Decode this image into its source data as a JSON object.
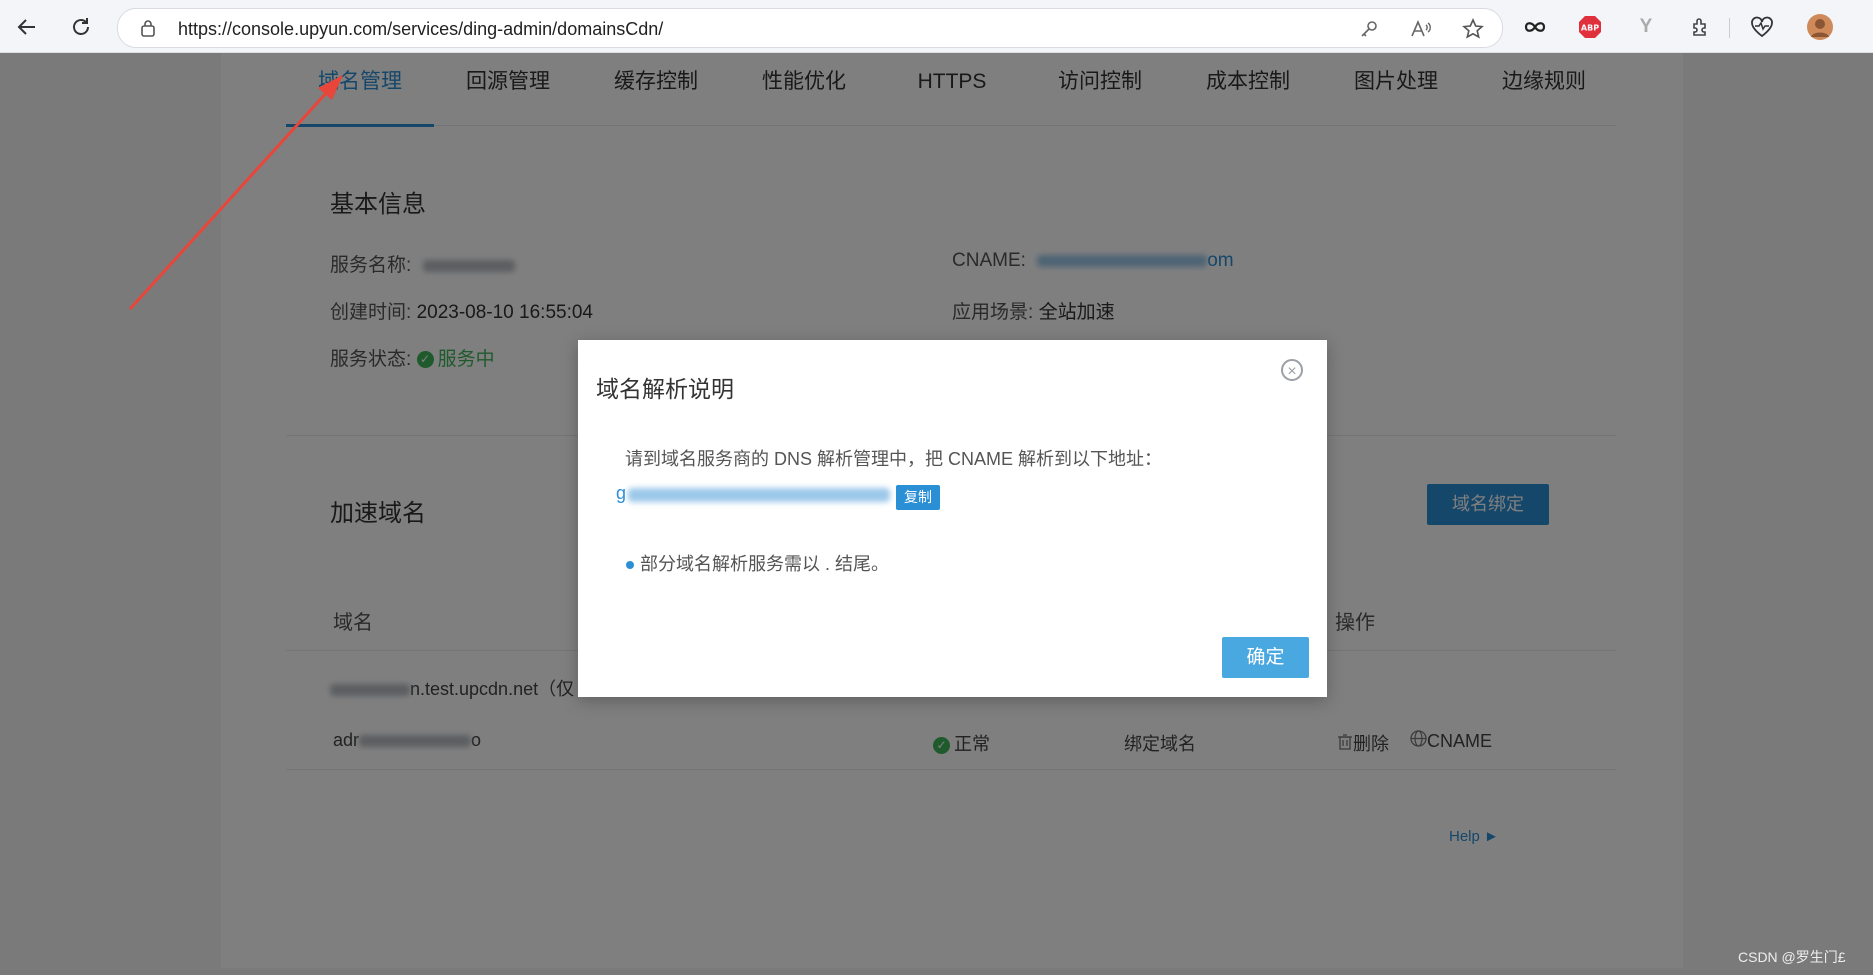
{
  "browser": {
    "url": "https://console.upyun.com/services/ding-admin/domainsCdn/",
    "icons": [
      "back-icon",
      "refresh-icon",
      "lock-icon",
      "key-icon",
      "read-aloud-icon",
      "favorite-star-icon",
      "infinity-icon",
      "abp-icon",
      "y-extension-icon",
      "extensions-icon",
      "heart-pulse-icon",
      "profile-avatar"
    ],
    "abp_label": "ABP",
    "ext_y_label": "Y"
  },
  "tabs": [
    {
      "label": "域名管理",
      "active": true
    },
    {
      "label": "回源管理"
    },
    {
      "label": "缓存控制"
    },
    {
      "label": "性能优化"
    },
    {
      "label": "HTTPS"
    },
    {
      "label": "访问控制"
    },
    {
      "label": "成本控制"
    },
    {
      "label": "图片处理"
    },
    {
      "label": "边缘规则"
    }
  ],
  "basic_info": {
    "title": "基本信息",
    "service_name_label": "服务名称:",
    "cname_label": "CNAME:",
    "cname_suffix": "om",
    "created_label": "创建时间:",
    "created_value": "2023-08-10 16:55:04",
    "scenario_label": "应用场景:",
    "scenario_value": "全站加速",
    "status_label": "服务状态:",
    "status_value": "服务中"
  },
  "accel_domains": {
    "title": "加速域名",
    "bind_button": "域名绑定",
    "col_domain": "域名",
    "col_ops": "操作",
    "row1_domain_suffix": "n.test.upcdn.net（仅",
    "row2_domain_prefix": "adr",
    "row2_domain_suffix": "o",
    "row2_status": "正常",
    "row2_type": "绑定域名",
    "row2_delete": "删除",
    "row2_cname": "CNAME"
  },
  "help_link": "Help ►",
  "dialog": {
    "title": "域名解析说明",
    "instruction": "请到域名服务商的 DNS 解析管理中，把 CNAME 解析到以下地址：",
    "cname_prefix": "g",
    "copy_button": "复制",
    "note": "部分域名解析服务需以 . 结尾。",
    "confirm_button": "确定"
  },
  "watermark": "CSDN @罗生门£",
  "colors": {
    "accent": "#2b8fd6",
    "success": "#3fb55b",
    "arrow": "#e8463a"
  }
}
